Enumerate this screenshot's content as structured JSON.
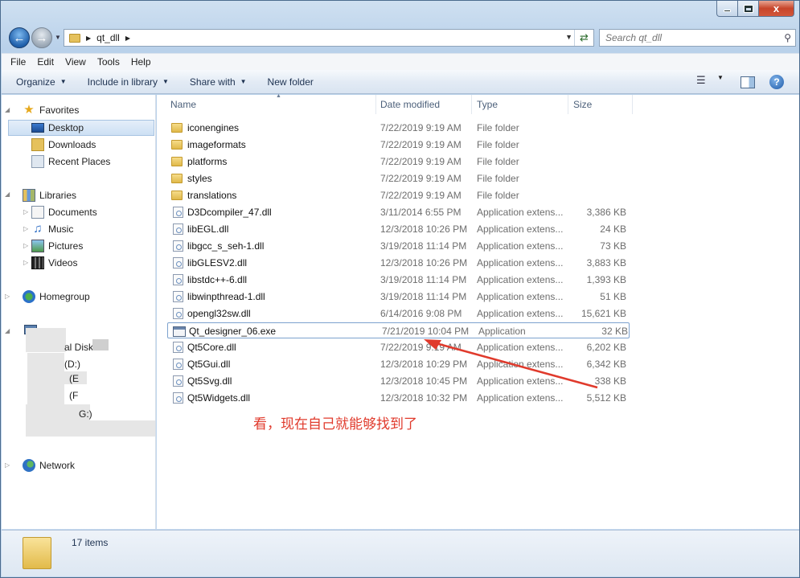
{
  "window": {
    "close_glyph": "x"
  },
  "address_bar": {
    "path_segment": "qt_dll",
    "folder_icon": "folder-icon"
  },
  "search": {
    "placeholder": "Search qt_dll"
  },
  "menubar": {
    "items": [
      "File",
      "Edit",
      "View",
      "Tools",
      "Help"
    ]
  },
  "command_bar": {
    "organize": "Organize",
    "include_in_library": "Include in library",
    "share_with": "Share with",
    "new_folder": "New folder"
  },
  "nav_pane": {
    "favorites": "Favorites",
    "desktop": "Desktop",
    "downloads": "Downloads",
    "recent_places": "Recent Places",
    "libraries": "Libraries",
    "documents": "Documents",
    "music": "Music",
    "pictures": "Pictures",
    "videos": "Videos",
    "homegroup": "Homegroup",
    "local_disk_partial": "al Disk",
    "drive_d_partial": "(D:)",
    "drive_e_partial": "(E",
    "drive_f_partial": "(F",
    "drive_g_partial": "G:)",
    "network": "Network"
  },
  "columns": {
    "name": "Name",
    "date_modified": "Date modified",
    "type": "Type",
    "size": "Size"
  },
  "files": [
    {
      "name": "iconengines",
      "date": "7/22/2019 9:19 AM",
      "type": "File folder",
      "size": "",
      "kind": "folder"
    },
    {
      "name": "imageformats",
      "date": "7/22/2019 9:19 AM",
      "type": "File folder",
      "size": "",
      "kind": "folder"
    },
    {
      "name": "platforms",
      "date": "7/22/2019 9:19 AM",
      "type": "File folder",
      "size": "",
      "kind": "folder"
    },
    {
      "name": "styles",
      "date": "7/22/2019 9:19 AM",
      "type": "File folder",
      "size": "",
      "kind": "folder"
    },
    {
      "name": "translations",
      "date": "7/22/2019 9:19 AM",
      "type": "File folder",
      "size": "",
      "kind": "folder"
    },
    {
      "name": "D3Dcompiler_47.dll",
      "date": "3/11/2014 6:55 PM",
      "type": "Application extens...",
      "size": "3,386 KB",
      "kind": "dll"
    },
    {
      "name": "libEGL.dll",
      "date": "12/3/2018 10:26 PM",
      "type": "Application extens...",
      "size": "24 KB",
      "kind": "dll"
    },
    {
      "name": "libgcc_s_seh-1.dll",
      "date": "3/19/2018 11:14 PM",
      "type": "Application extens...",
      "size": "73 KB",
      "kind": "dll"
    },
    {
      "name": "libGLESV2.dll",
      "date": "12/3/2018 10:26 PM",
      "type": "Application extens...",
      "size": "3,883 KB",
      "kind": "dll"
    },
    {
      "name": "libstdc++-6.dll",
      "date": "3/19/2018 11:14 PM",
      "type": "Application extens...",
      "size": "1,393 KB",
      "kind": "dll"
    },
    {
      "name": "libwinpthread-1.dll",
      "date": "3/19/2018 11:14 PM",
      "type": "Application extens...",
      "size": "51 KB",
      "kind": "dll"
    },
    {
      "name": "opengl32sw.dll",
      "date": "6/14/2016 9:08 PM",
      "type": "Application extens...",
      "size": "15,621 KB",
      "kind": "dll"
    },
    {
      "name": "Qt_designer_06.exe",
      "date": "7/21/2019 10:04 PM",
      "type": "Application",
      "size": "32 KB",
      "kind": "exe"
    },
    {
      "name": "Qt5Core.dll",
      "date": "7/22/2019 9:19 AM",
      "type": "Application extens...",
      "size": "6,202 KB",
      "kind": "dll"
    },
    {
      "name": "Qt5Gui.dll",
      "date": "12/3/2018 10:29 PM",
      "type": "Application extens...",
      "size": "6,342 KB",
      "kind": "dll"
    },
    {
      "name": "Qt5Svg.dll",
      "date": "12/3/2018 10:45 PM",
      "type": "Application extens...",
      "size": "338 KB",
      "kind": "dll"
    },
    {
      "name": "Qt5Widgets.dll",
      "date": "12/3/2018 10:32 PM",
      "type": "Application extens...",
      "size": "5,512 KB",
      "kind": "dll"
    }
  ],
  "annotation": {
    "text": "看，现在自己就能够找到了",
    "color": "#e03a2c"
  },
  "status_bar": {
    "item_count": "17 items"
  }
}
